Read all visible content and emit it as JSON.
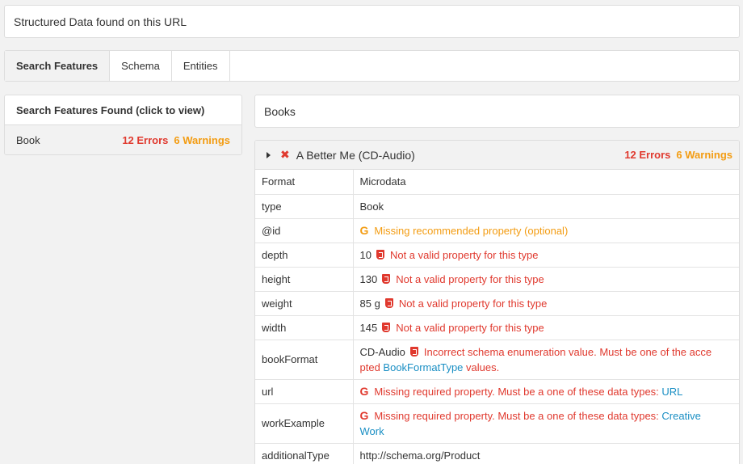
{
  "header": {
    "title": "Structured Data found on this URL"
  },
  "tabs": [
    {
      "label": "Search Features",
      "active": true
    },
    {
      "label": "Schema",
      "active": false
    },
    {
      "label": "Entities",
      "active": false
    }
  ],
  "left_panel": {
    "heading": "Search Features Found (click to view)",
    "items": [
      {
        "label": "Book",
        "errors": "12 Errors",
        "warnings": "6 Warnings"
      }
    ]
  },
  "books_box": {
    "label": "Books"
  },
  "detail": {
    "title": "A Better Me (CD-Audio)",
    "errors": "12 Errors",
    "warnings": "6 Warnings",
    "rows": [
      {
        "key": "Format",
        "value": "Microdata"
      },
      {
        "key": "type",
        "value": "Book"
      },
      {
        "key": "@id",
        "g": "G",
        "message": "Missing recommended property (optional)"
      },
      {
        "key": "depth",
        "value": "10",
        "message": "Not a valid property for this type"
      },
      {
        "key": "height",
        "value": "130",
        "message": "Not a valid property for this type"
      },
      {
        "key": "weight",
        "value": "85 g",
        "message": "Not a valid property for this type"
      },
      {
        "key": "width",
        "value": "145",
        "message": "Not a valid property for this type"
      },
      {
        "key": "bookFormat",
        "value": "CD-Audio",
        "message_line1": "Incorrect schema enumeration value. Must be one of the acce",
        "message_pre": "pted ",
        "link": "BookFormatType",
        "message_post": " values."
      },
      {
        "key": "url",
        "g": "G",
        "message": "Missing required property. Must be a one of these data types: ",
        "link": "URL"
      },
      {
        "key": "workExample",
        "g": "G",
        "message": "Missing required property. Must be a one of these data types: ",
        "link_line1": "Creative",
        "link_line2": "Work"
      },
      {
        "key": "additionalType",
        "value": "http://schema.org/Product"
      }
    ]
  },
  "colors": {
    "error": "#e0392e",
    "warning": "#f39c12",
    "link": "#1a8fc4"
  },
  "icons": {
    "google": "google-icon",
    "html5": "html5-icon",
    "error_x": "error-x-icon",
    "caret": "caret-right-icon"
  }
}
